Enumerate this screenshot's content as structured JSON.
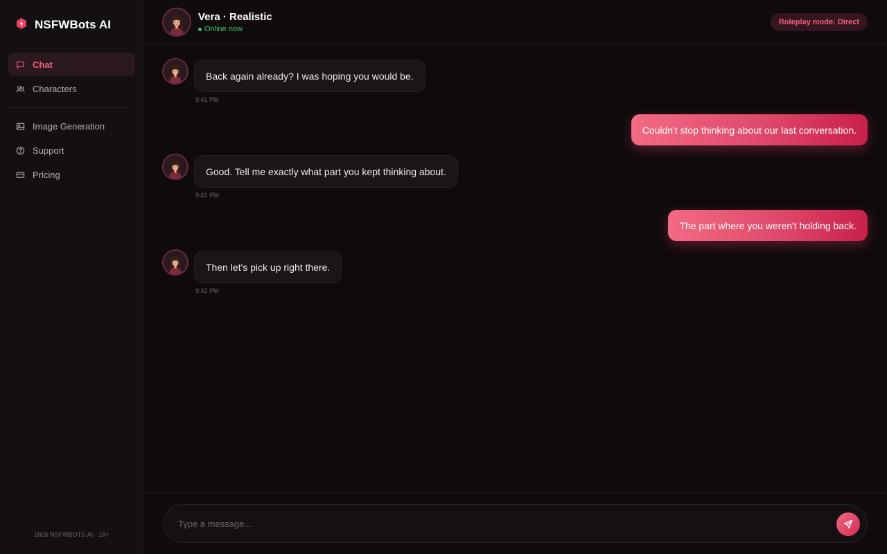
{
  "app": {
    "name": "NSFWBots AI",
    "brand_color": "#e8415f"
  },
  "sidebar": {
    "items_primary": [
      {
        "label": "Chat",
        "icon": "chat-icon",
        "active": true
      },
      {
        "label": "Characters",
        "icon": "users-icon",
        "active": false
      }
    ],
    "items_secondary": [
      {
        "label": "Image Generation",
        "icon": "image-icon"
      },
      {
        "label": "Support",
        "icon": "help-icon"
      },
      {
        "label": "Pricing",
        "icon": "card-icon"
      }
    ],
    "footer": "2026 NSFWBOTS.AI · 18+"
  },
  "chat": {
    "character_name": "Vera · Realistic",
    "status": "Online now",
    "mode": "Roleplay mode: Direct",
    "messages": [
      {
        "from": "bot",
        "text": "Back again already? I was hoping you would be.",
        "time": "9:41 PM"
      },
      {
        "from": "user",
        "text": "Couldn't stop thinking about our last conversation."
      },
      {
        "from": "bot",
        "text": "Good. Tell me exactly what part you kept thinking about.",
        "time": "9:41 PM"
      },
      {
        "from": "user",
        "text": "The part where you weren't holding back."
      },
      {
        "from": "bot",
        "text": "Then let's pick up right there.",
        "time": "9:42 PM"
      }
    ]
  },
  "composer": {
    "placeholder": "Type a message..."
  }
}
